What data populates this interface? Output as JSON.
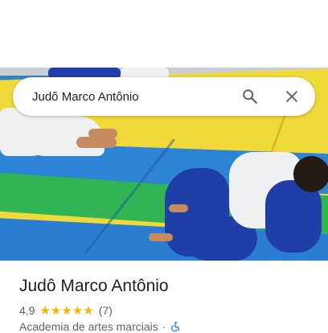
{
  "search": {
    "query": "Judô Marco Antônio",
    "search_icon": "search-icon",
    "close_icon": "close-icon"
  },
  "place": {
    "name": "Judô Marco Antônio",
    "rating": "4,9",
    "rating_stars": 5,
    "review_count": "(7)",
    "category": "Academia de artes marciais",
    "separator": "·",
    "accessibility_icon": "wheelchair-icon"
  },
  "colors": {
    "star": "#f6b500",
    "title": "#202124",
    "secondary_text": "#5f6368",
    "accessibility_icon": "#1a73e8"
  }
}
